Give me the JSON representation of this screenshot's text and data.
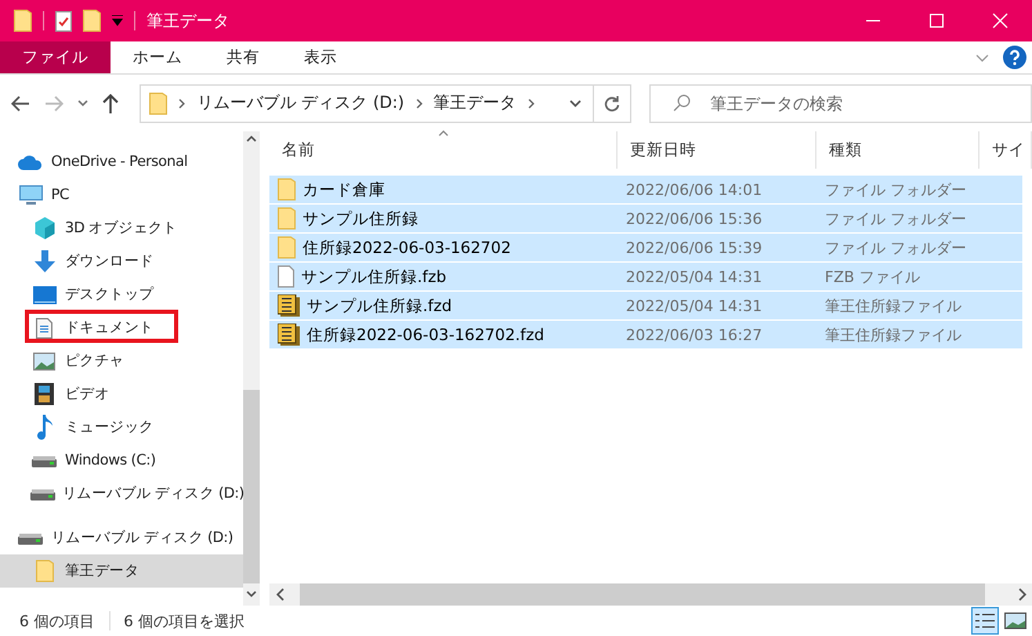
{
  "window": {
    "title": "筆王データ"
  },
  "ribbon": {
    "tabs": [
      {
        "label": "ファイル",
        "selected": true
      },
      {
        "label": "ホーム",
        "selected": false
      },
      {
        "label": "共有",
        "selected": false
      },
      {
        "label": "表示",
        "selected": false
      }
    ]
  },
  "address": {
    "path": [
      "リムーバブル ディスク (D:)",
      "筆王データ"
    ]
  },
  "search": {
    "placeholder": "筆王データの検索"
  },
  "sidebar": {
    "items": [
      {
        "label": "OneDrive - Personal",
        "kind": "cloud",
        "selected": false,
        "highlighted": false
      },
      {
        "label": "PC",
        "kind": "pc",
        "selected": false,
        "highlighted": false,
        "children": [
          {
            "label": "3D オブジェクト",
            "kind": "cube",
            "selected": false,
            "highlighted": false
          },
          {
            "label": "ダウンロード",
            "kind": "download",
            "selected": false,
            "highlighted": false
          },
          {
            "label": "デスクトップ",
            "kind": "desktop",
            "selected": false,
            "highlighted": false
          },
          {
            "label": "ドキュメント",
            "kind": "document",
            "selected": false,
            "highlighted": true
          },
          {
            "label": "ピクチャ",
            "kind": "picture",
            "selected": false,
            "highlighted": false
          },
          {
            "label": "ビデオ",
            "kind": "film",
            "selected": false,
            "highlighted": false
          },
          {
            "label": "ミュージック",
            "kind": "music",
            "selected": false,
            "highlighted": false
          },
          {
            "label": "Windows (C:)",
            "kind": "drive",
            "selected": false,
            "highlighted": false
          },
          {
            "label": "リムーバブル ディスク (D:)",
            "kind": "drive",
            "selected": false,
            "highlighted": false
          }
        ]
      },
      {
        "label": "リムーバブル ディスク (D:)",
        "kind": "drive",
        "selected": false,
        "highlighted": false,
        "children": [
          {
            "label": "筆王データ",
            "kind": "folder",
            "selected": true,
            "highlighted": false
          }
        ]
      }
    ]
  },
  "table": {
    "columns": [
      "名前",
      "更新日時",
      "種類",
      "サイ"
    ],
    "rows": [
      {
        "kind": "folder",
        "name": "カード倉庫",
        "modified": "2022/06/06 14:01",
        "type": "ファイル フォルダー",
        "selected": true
      },
      {
        "kind": "folder",
        "name": "サンプル住所録",
        "modified": "2022/06/06 15:36",
        "type": "ファイル フォルダー",
        "selected": true
      },
      {
        "kind": "folder",
        "name": "住所録2022-06-03-162702",
        "modified": "2022/06/06 15:39",
        "type": "ファイル フォルダー",
        "selected": true
      },
      {
        "kind": "file",
        "name": "サンプル住所録.fzb",
        "modified": "2022/05/04 14:31",
        "type": "FZB ファイル",
        "selected": true
      },
      {
        "kind": "app",
        "name": "サンプル住所録.fzd",
        "modified": "2022/05/04 14:31",
        "type": "筆王住所録ファイル",
        "selected": true
      },
      {
        "kind": "app",
        "name": "住所録2022-06-03-162702.fzd",
        "modified": "2022/06/03 16:27",
        "type": "筆王住所録ファイル",
        "selected": true
      }
    ]
  },
  "status_bar": {
    "count": "6 個の項目",
    "selection": "6 個の項目を選択"
  }
}
